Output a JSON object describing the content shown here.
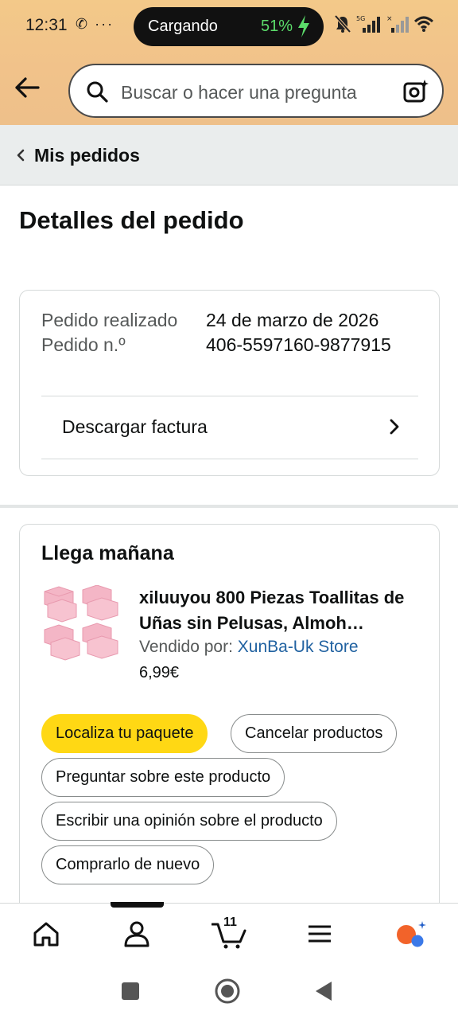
{
  "status_bar": {
    "time": "12:31",
    "left_icons": "✆ ···",
    "charging_label": "Cargando",
    "battery_percent": "51%",
    "icons": [
      "mute-bell-icon",
      "5g-signal-icon",
      "signal-icon",
      "wifi-icon"
    ]
  },
  "header": {
    "search_placeholder": "Buscar o hacer una pregunta",
    "colors": {
      "background": "#f1c28a",
      "search_border": "#4a4a4a"
    }
  },
  "breadcrumb": {
    "label": "Mis pedidos"
  },
  "page": {
    "title": "Detalles del pedido"
  },
  "order_info": {
    "placed_label": "Pedido realizado",
    "placed_value": "24 de marzo de 2026",
    "number_label": "Pedido n.º",
    "number_value": "406-5597160-9877915",
    "invoice_label": "Descargar factura"
  },
  "shipment": {
    "arrival": "Llega mañana",
    "product_title": "xiluuyou 800 Piezas Toallitas de Uñas sin Pelusas, Almoh…",
    "seller_prefix": "Vendido por: ",
    "seller_name": "XunBa-Uk Store",
    "price": "6,99€",
    "buttons": {
      "track": "Localiza tu paquete",
      "cancel": "Cancelar productos",
      "ask": "Preguntar sobre este producto",
      "review": "Escribir una opinión sobre el producto",
      "rebuy": "Comprarlo de nuevo"
    },
    "colors": {
      "primary_button": "#ffd814",
      "seller_link": "#2162a1"
    }
  },
  "bottom_nav": {
    "items": [
      "home-icon",
      "account-icon",
      "cart-icon",
      "menu-icon",
      "rufus-assistant-icon"
    ],
    "cart_count": "11",
    "active": "account-icon"
  },
  "system_nav": [
    "recents-icon",
    "home-circle-icon",
    "back-triangle-icon"
  ]
}
